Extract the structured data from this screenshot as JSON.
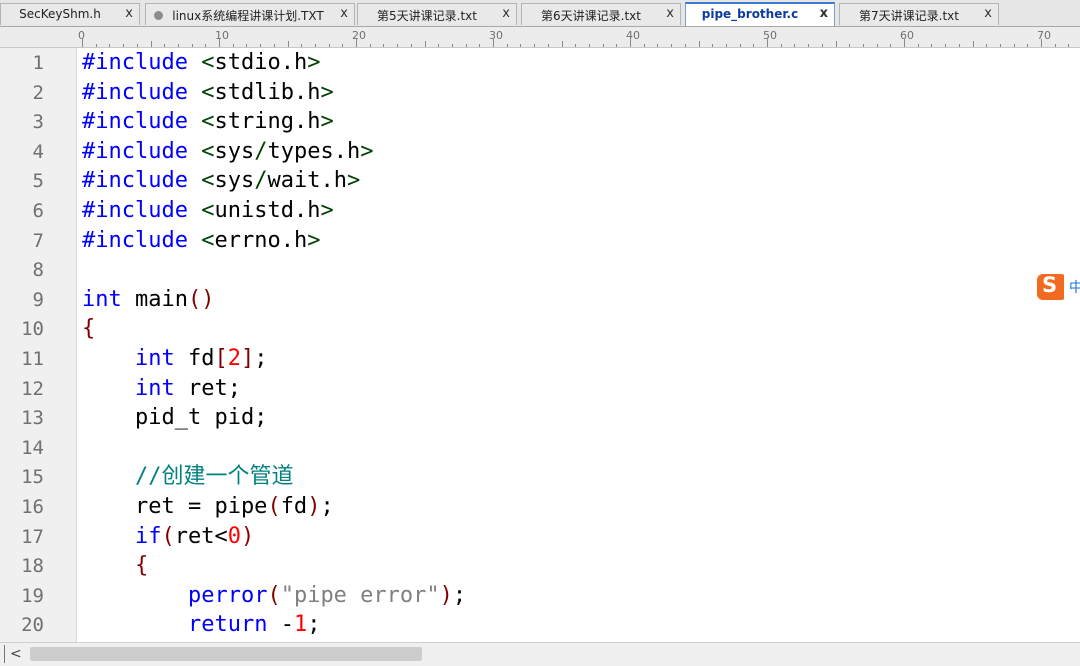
{
  "tabs": [
    {
      "label": "SecKeyShm.h",
      "close": "x",
      "active": false,
      "dot": false
    },
    {
      "label": "linux系统编程讲课计划.TXT",
      "close": "x",
      "active": false,
      "dot": true
    },
    {
      "label": "第5天讲课记录.txt",
      "close": "x",
      "active": false,
      "dot": false
    },
    {
      "label": "第6天讲课记录.txt",
      "close": "x",
      "active": false,
      "dot": false
    },
    {
      "label": "pipe_brother.c",
      "close": "x",
      "active": true,
      "dot": false
    },
    {
      "label": "第7天讲课记录.txt",
      "close": "x",
      "active": false,
      "dot": false
    }
  ],
  "ruler": {
    "labels": [
      "0",
      "10",
      "20",
      "30",
      "40",
      "50",
      "60",
      "70"
    ]
  },
  "editor": {
    "line_numbers": [
      "1",
      "2",
      "3",
      "4",
      "5",
      "6",
      "7",
      "8",
      "9",
      "10",
      "11",
      "12",
      "13",
      "14",
      "15",
      "16",
      "17",
      "18",
      "19",
      "20"
    ],
    "lines": [
      [
        {
          "t": "#include ",
          "c": "kw"
        },
        {
          "t": "<",
          "c": "ang"
        },
        {
          "t": "stdio",
          "c": "hdr"
        },
        {
          "t": ".",
          "c": "op"
        },
        {
          "t": "h",
          "c": "hdr"
        },
        {
          "t": ">",
          "c": "ang"
        }
      ],
      [
        {
          "t": "#include ",
          "c": "kw"
        },
        {
          "t": "<",
          "c": "ang"
        },
        {
          "t": "stdlib",
          "c": "hdr"
        },
        {
          "t": ".",
          "c": "op"
        },
        {
          "t": "h",
          "c": "hdr"
        },
        {
          "t": ">",
          "c": "ang"
        }
      ],
      [
        {
          "t": "#include ",
          "c": "kw"
        },
        {
          "t": "<",
          "c": "ang"
        },
        {
          "t": "string",
          "c": "hdr"
        },
        {
          "t": ".",
          "c": "op"
        },
        {
          "t": "h",
          "c": "hdr"
        },
        {
          "t": ">",
          "c": "ang"
        }
      ],
      [
        {
          "t": "#include ",
          "c": "kw"
        },
        {
          "t": "<",
          "c": "ang"
        },
        {
          "t": "sys",
          "c": "hdr"
        },
        {
          "t": "/",
          "c": "ang"
        },
        {
          "t": "types",
          "c": "hdr"
        },
        {
          "t": ".",
          "c": "op"
        },
        {
          "t": "h",
          "c": "hdr"
        },
        {
          "t": ">",
          "c": "ang"
        }
      ],
      [
        {
          "t": "#include ",
          "c": "kw"
        },
        {
          "t": "<",
          "c": "ang"
        },
        {
          "t": "sys",
          "c": "hdr"
        },
        {
          "t": "/",
          "c": "ang"
        },
        {
          "t": "wait",
          "c": "hdr"
        },
        {
          "t": ".",
          "c": "op"
        },
        {
          "t": "h",
          "c": "hdr"
        },
        {
          "t": ">",
          "c": "ang"
        }
      ],
      [
        {
          "t": "#include ",
          "c": "kw"
        },
        {
          "t": "<",
          "c": "ang"
        },
        {
          "t": "unistd",
          "c": "hdr"
        },
        {
          "t": ".",
          "c": "op"
        },
        {
          "t": "h",
          "c": "hdr"
        },
        {
          "t": ">",
          "c": "ang"
        }
      ],
      [
        {
          "t": "#include ",
          "c": "kw"
        },
        {
          "t": "<",
          "c": "ang"
        },
        {
          "t": "errno",
          "c": "hdr"
        },
        {
          "t": ".",
          "c": "op"
        },
        {
          "t": "h",
          "c": "hdr"
        },
        {
          "t": ">",
          "c": "ang"
        }
      ],
      [],
      [
        {
          "t": "int",
          "c": "kw"
        },
        {
          "t": " main",
          "c": "op"
        },
        {
          "t": "()",
          "c": "br"
        }
      ],
      [
        {
          "t": "{",
          "c": "br"
        }
      ],
      [
        {
          "t": "    ",
          "c": "op"
        },
        {
          "t": "int",
          "c": "kw"
        },
        {
          "t": " fd",
          "c": "op"
        },
        {
          "t": "[",
          "c": "br"
        },
        {
          "t": "2",
          "c": "num"
        },
        {
          "t": "]",
          "c": "br"
        },
        {
          "t": ";",
          "c": "op"
        }
      ],
      [
        {
          "t": "    ",
          "c": "op"
        },
        {
          "t": "int",
          "c": "kw"
        },
        {
          "t": " ret;",
          "c": "op"
        }
      ],
      [
        {
          "t": "    pid_t pid;",
          "c": "op"
        }
      ],
      [],
      [
        {
          "t": "    ",
          "c": "op"
        },
        {
          "t": "//创建一个管道",
          "c": "cm"
        }
      ],
      [
        {
          "t": "    ret = pipe",
          "c": "op"
        },
        {
          "t": "(",
          "c": "br"
        },
        {
          "t": "fd",
          "c": "op"
        },
        {
          "t": ")",
          "c": "br"
        },
        {
          "t": ";",
          "c": "op"
        }
      ],
      [
        {
          "t": "    ",
          "c": "op"
        },
        {
          "t": "if",
          "c": "kw"
        },
        {
          "t": "(",
          "c": "br"
        },
        {
          "t": "ret<",
          "c": "op"
        },
        {
          "t": "0",
          "c": "num"
        },
        {
          "t": ")",
          "c": "br"
        }
      ],
      [
        {
          "t": "    ",
          "c": "op"
        },
        {
          "t": "{",
          "c": "br"
        }
      ],
      [
        {
          "t": "        ",
          "c": "op"
        },
        {
          "t": "perror",
          "c": "kw"
        },
        {
          "t": "(",
          "c": "br"
        },
        {
          "t": "\"pipe error\"",
          "c": "str"
        },
        {
          "t": ")",
          "c": "br"
        },
        {
          "t": ";",
          "c": "op"
        }
      ],
      [
        {
          "t": "        ",
          "c": "op"
        },
        {
          "t": "return",
          "c": "kw"
        },
        {
          "t": " -",
          "c": "op"
        },
        {
          "t": "1",
          "c": "num"
        },
        {
          "t": ";",
          "c": "op"
        }
      ]
    ]
  },
  "ime_badge": {
    "logo": "S",
    "text": "中"
  },
  "scrollbar": {
    "left_arrow": "<"
  }
}
